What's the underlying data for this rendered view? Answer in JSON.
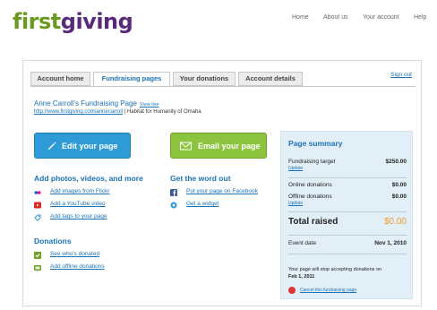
{
  "logo": {
    "part1": "first",
    "part2": "giving"
  },
  "topnav": {
    "home": "Home",
    "about": "About us",
    "account": "Your account",
    "help": "Help"
  },
  "tabs": {
    "account_home": "Account home",
    "fundraising_pages": "Fundraising pages",
    "your_donations": "Your donations",
    "account_details": "Account details"
  },
  "signout": "Sign out",
  "page": {
    "title": "Anne Carroll's Fundraising Page",
    "view_live": "View live",
    "url": "http://www.firstgiving.com/annecarroll",
    "charity": " | Habitat for Humanity of Omaha"
  },
  "buttons": {
    "edit": "Edit your page",
    "email": "Email your page"
  },
  "media": {
    "heading": "Add photos, videos, and more",
    "flickr": "Add images from Flickr",
    "youtube": "Add a YouTube video",
    "tags": "Add tags to your page"
  },
  "share": {
    "heading": "Get the word out",
    "facebook": "Put your page on Facebook",
    "widget": "Get a widget"
  },
  "donations": {
    "heading": "Donations",
    "see": "See who's donated",
    "offline": "Add offline donations"
  },
  "summary": {
    "title": "Page summary",
    "target_label": "Fundraising target",
    "target_value": "$250.00",
    "update": "Update",
    "online_label": "Online donations",
    "online_value": "$0.00",
    "offline_label": "Offline donations",
    "offline_value": "$0.00",
    "total_label": "Total raised",
    "total_value": "$0.00",
    "event_label": "Event date",
    "event_value": "Nov 1, 2010",
    "note": "Your page will stop accepting donations on",
    "note_date": "Feb 1, 2011",
    "cancel": "Cancel this fundraising page"
  },
  "colors": {
    "brand_green": "#6a9a1f",
    "brand_purple": "#5a2a7a",
    "link_blue": "#1a72b8",
    "edit_blue": "#2e9bd6",
    "email_green": "#8cc43f",
    "total_orange": "#f29a2e"
  }
}
